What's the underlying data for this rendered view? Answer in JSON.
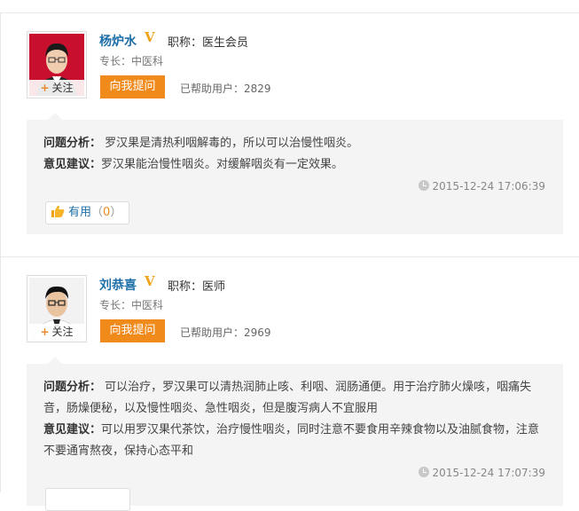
{
  "answers": [
    {
      "doctor_name": "杨炉水",
      "verified_mark": "V",
      "title_text": "职称：医生会员",
      "specialty_text": "专长：中医科",
      "follow_label": "关注",
      "ask_label": "向我提问",
      "helped_text": "已帮助用户：2829",
      "analysis_label": "问题分析：",
      "analysis_text": "罗汉果是清热利咽解毒的，所以可以治慢性咽炎。",
      "advice_label": "意见建议：",
      "advice_text": "罗汉果能治慢性咽炎。对缓解咽炎有一定效果。",
      "timestamp": "2015-12-24 17:06:39",
      "useful_label": "有用",
      "useful_open": "（",
      "useful_count": "0",
      "useful_close": "）",
      "avatar_bg": "#c8102e"
    },
    {
      "doctor_name": "刘恭喜",
      "verified_mark": "V",
      "title_text": "职称：医师",
      "specialty_text": "专长：中医科",
      "follow_label": "关注",
      "ask_label": "向我提问",
      "helped_text": "已帮助用户：2969",
      "analysis_label": "问题分析：",
      "analysis_text": "可以治疗，罗汉果可以清热润肺止咳、利咽、润肠通便。用于治疗肺火燥咳，咽痛失音，肠燥便秘，以及慢性咽炎、急性咽炎，但是腹泻病人不宜服用",
      "advice_label": "意见建议：",
      "advice_text": "可以用罗汉果代茶饮，治疗慢性咽炎，同时注意不要食用辛辣食物以及油腻食物，注意不要通宵熬夜，保持心态平和",
      "timestamp": "2015-12-24 17:07:39",
      "avatar_bg": "#f2f2f2"
    }
  ],
  "colors": {
    "accent_orange": "#f08a1a",
    "name_blue": "#1e6fa8",
    "verified_gold": "#f0a31a",
    "bubble_bg": "#f4f4f4"
  }
}
